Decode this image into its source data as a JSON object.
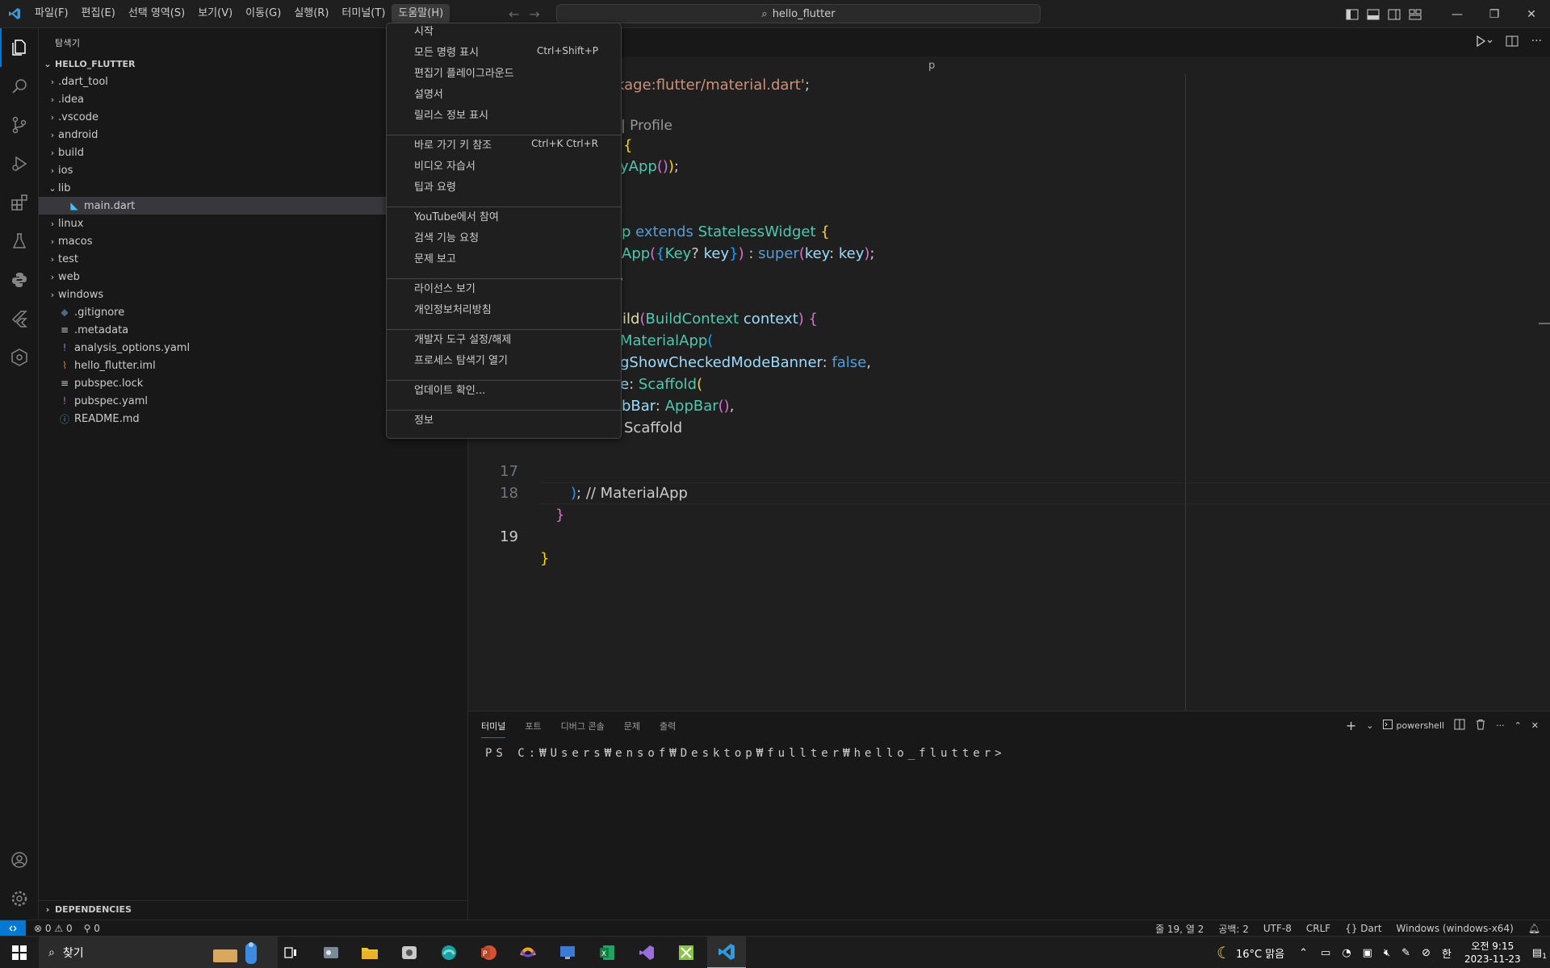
{
  "menubar": {
    "items": [
      "파일(F)",
      "편집(E)",
      "선택 영역(S)",
      "보기(V)",
      "이동(G)",
      "실행(R)",
      "터미널(T)",
      "도움말(H)"
    ]
  },
  "command_center": {
    "label": "hello_flutter"
  },
  "sidebar": {
    "title": "탐색기",
    "project": "HELLO_FLUTTER",
    "tree": [
      {
        "label": ".dart_tool",
        "kind": "folder"
      },
      {
        "label": ".idea",
        "kind": "folder"
      },
      {
        "label": ".vscode",
        "kind": "folder"
      },
      {
        "label": "android",
        "kind": "folder"
      },
      {
        "label": "build",
        "kind": "folder"
      },
      {
        "label": "ios",
        "kind": "folder"
      },
      {
        "label": "lib",
        "kind": "folder-open"
      },
      {
        "label": "main.dart",
        "kind": "dart-file"
      },
      {
        "label": "linux",
        "kind": "folder"
      },
      {
        "label": "macos",
        "kind": "folder"
      },
      {
        "label": "test",
        "kind": "folder"
      },
      {
        "label": "web",
        "kind": "folder"
      },
      {
        "label": "windows",
        "kind": "folder"
      },
      {
        "label": ".gitignore",
        "kind": "git-file"
      },
      {
        "label": ".metadata",
        "kind": "text-file"
      },
      {
        "label": "analysis_options.yaml",
        "kind": "yaml-file"
      },
      {
        "label": "hello_flutter.iml",
        "kind": "rss-file"
      },
      {
        "label": "pubspec.lock",
        "kind": "text-file"
      },
      {
        "label": "pubspec.yaml",
        "kind": "yaml-file"
      },
      {
        "label": "README.md",
        "kind": "info-file"
      }
    ],
    "dependencies": "DEPENDENCIES"
  },
  "editor": {
    "breadcrumb": "p",
    "line_numbers": [
      "17",
      "18",
      "19"
    ],
    "codelens_profile": "| Profile"
  },
  "help_menu": {
    "items": [
      {
        "label": "시작",
        "shortcut": ""
      },
      {
        "label": "모든 명령 표시",
        "shortcut": "Ctrl+Shift+P"
      },
      {
        "label": "편집기 플레이그라운드",
        "shortcut": ""
      },
      {
        "label": "설명서",
        "shortcut": ""
      },
      {
        "label": "릴리스 정보 표시",
        "shortcut": ""
      },
      {
        "label": "바로 가기 키 참조",
        "shortcut": "Ctrl+K Ctrl+R"
      },
      {
        "label": "비디오 자습서",
        "shortcut": ""
      },
      {
        "label": "팁과 요령",
        "shortcut": ""
      },
      {
        "label": "YouTube에서 참여",
        "shortcut": ""
      },
      {
        "label": "검색 기능 요청",
        "shortcut": ""
      },
      {
        "label": "문제 보고",
        "shortcut": ""
      },
      {
        "label": "라이선스 보기",
        "shortcut": ""
      },
      {
        "label": "개인정보처리방침",
        "shortcut": ""
      },
      {
        "label": "개발자 도구 설정/해제",
        "shortcut": ""
      },
      {
        "label": "프로세스 탐색기 열기",
        "shortcut": ""
      },
      {
        "label": "업데이트 확인...",
        "shortcut": ""
      },
      {
        "label": "정보",
        "shortcut": ""
      }
    ]
  },
  "panel": {
    "tabs": [
      "터미널",
      "포트",
      "디버그 콘솔",
      "문제",
      "출력"
    ],
    "shell_label": "powershell",
    "terminal_prompt": "PS C:₩Users₩ensof₩Desktop₩fullter₩hello_flutter>"
  },
  "statusbar": {
    "errors": "0",
    "warnings": "0",
    "ports": "0",
    "position": "줄 19, 열 2",
    "spaces": "공백: 2",
    "encoding": "UTF-8",
    "eol": "CRLF",
    "language": "Dart",
    "platform": "Windows (windows-x64)"
  },
  "taskbar": {
    "search_placeholder": "찾기",
    "weather": "16°C 맑음",
    "ime": "한",
    "time": "오전 9:15",
    "date": "2023-11-23",
    "notification_count": "1"
  }
}
